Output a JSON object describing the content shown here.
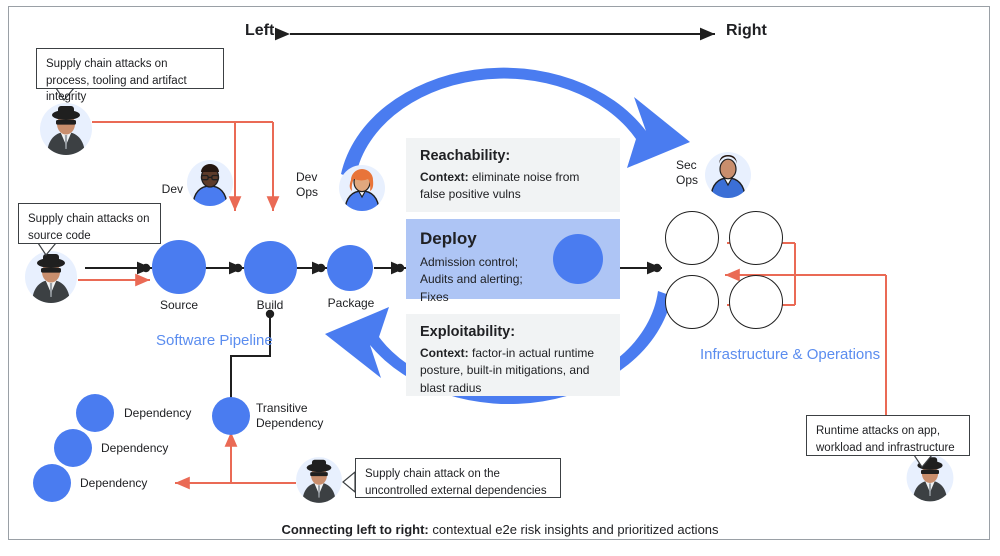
{
  "axis": {
    "left_label": "Left",
    "right_label": "Right"
  },
  "callouts": [
    {
      "id": "process-tooling",
      "text": "Supply chain attacks on process,\ntooling and artifact integrity"
    },
    {
      "id": "source-code",
      "text": "Supply chain attacks\non source code"
    },
    {
      "id": "external-deps",
      "text": "Supply chain attack on the\nuncontrolled external dependencies"
    },
    {
      "id": "runtime",
      "text": "Runtime attacks on app,\nworkload and infrastructure"
    }
  ],
  "personas": [
    {
      "id": "dev",
      "label": "Dev"
    },
    {
      "id": "devops",
      "label": "Dev\nOps"
    },
    {
      "id": "secops",
      "label": "Sec\nOps"
    }
  ],
  "pipeline": {
    "title": "Software\nPipeline",
    "nodes": [
      {
        "id": "source",
        "label": "Source",
        "icon": "link-icon"
      },
      {
        "id": "build",
        "label": "Build",
        "icon": "gear-icon"
      },
      {
        "id": "package",
        "label": "Package",
        "icon": "package-square-icon"
      }
    ],
    "transitive": {
      "label": "Transitive\nDependency",
      "icon": "merge-icon"
    },
    "dependencies": [
      {
        "label": "Dependency"
      },
      {
        "label": "Dependency"
      },
      {
        "label": "Dependency"
      }
    ]
  },
  "panels": [
    {
      "id": "reachability",
      "title": "Reachability:",
      "context_label": "Context:",
      "body": " eliminate noise from false positive vulns",
      "style": "gray"
    },
    {
      "id": "deploy",
      "title": "Deploy",
      "body": "Admission control;\nAudits and alerting;\nFixes",
      "icon": "person-add-icon",
      "style": "blue"
    },
    {
      "id": "exploitability",
      "title": "Exploitability:",
      "context_label": "Context:",
      "body": " factor-in actual runtime posture, built-in mitigations, and blast radius",
      "style": "gray"
    }
  ],
  "infrastructure": {
    "title": "Infrastructure &\nOperations",
    "icons": [
      {
        "id": "chip",
        "name": "chip-icon"
      },
      {
        "id": "container",
        "name": "container-icon"
      },
      {
        "id": "monitoring",
        "name": "monitoring-search-icon"
      },
      {
        "id": "server",
        "name": "server-rack-icon"
      }
    ]
  },
  "footer": {
    "bold": "Connecting left to right:",
    "rest": " contextual e2e risk insights and prioritized actions"
  },
  "colors": {
    "blue": "#4a7cf0",
    "blue_light": "#aec5f5",
    "blue_arrow": "#4a7cf0",
    "red": "#ea6a55",
    "gray_panel": "#f1f3f4",
    "text": "#202124",
    "link_blue": "#5b8def",
    "avatar_bg": "#e8f0fe"
  }
}
